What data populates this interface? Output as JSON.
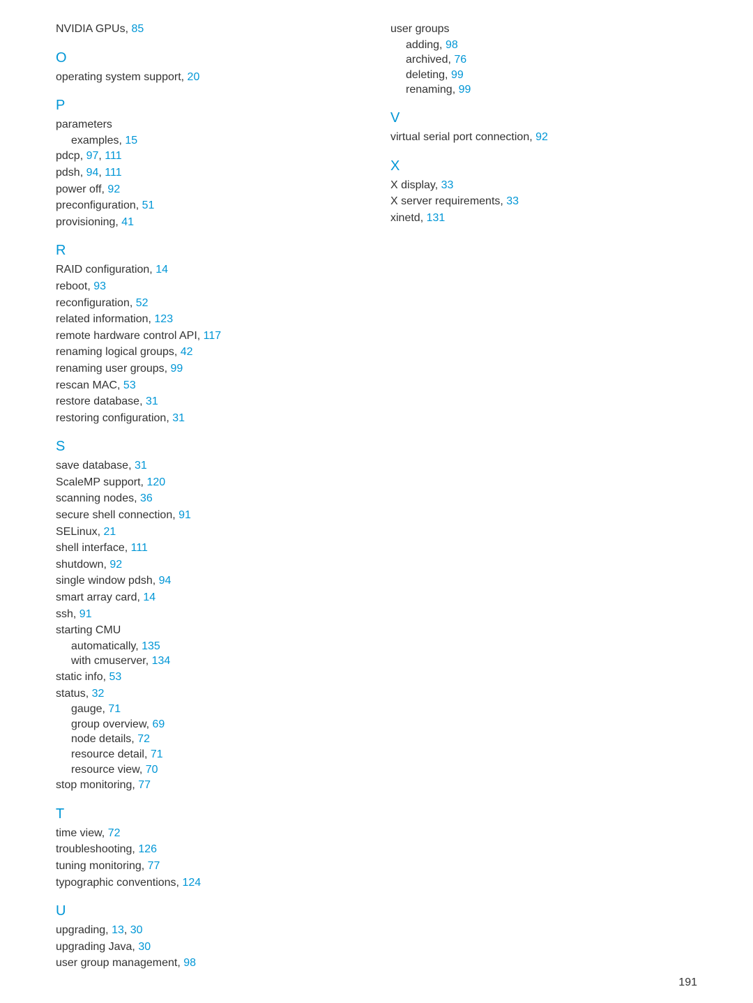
{
  "col1": {
    "prefix": {
      "label": "NVIDIA GPUs, ",
      "pages": "85"
    },
    "sections": [
      {
        "letter": "O",
        "entries": [
          {
            "label": "operating system support, ",
            "pages": "20"
          }
        ]
      },
      {
        "letter": "P",
        "entries": [
          {
            "label": "parameters"
          },
          {
            "label": "examples, ",
            "pages": "15",
            "sub": true
          },
          {
            "label": "pdcp, ",
            "pages": "97, 111"
          },
          {
            "label": "pdsh, ",
            "pages": "94, 111"
          },
          {
            "label": "power off, ",
            "pages": "92"
          },
          {
            "label": "preconfiguration, ",
            "pages": "51"
          },
          {
            "label": "provisioning, ",
            "pages": "41"
          }
        ]
      },
      {
        "letter": "R",
        "entries": [
          {
            "label": "RAID configuration, ",
            "pages": "14"
          },
          {
            "label": "reboot, ",
            "pages": "93"
          },
          {
            "label": "reconfiguration, ",
            "pages": "52"
          },
          {
            "label": "related information, ",
            "pages": "123"
          },
          {
            "label": "remote hardware control API, ",
            "pages": "117"
          },
          {
            "label": "renaming logical groups, ",
            "pages": "42"
          },
          {
            "label": "renaming user groups, ",
            "pages": "99"
          },
          {
            "label": "rescan MAC, ",
            "pages": "53"
          },
          {
            "label": "restore database, ",
            "pages": "31"
          },
          {
            "label": "restoring configuration, ",
            "pages": "31"
          }
        ]
      },
      {
        "letter": "S",
        "entries": [
          {
            "label": "save database, ",
            "pages": "31"
          },
          {
            "label": "ScaleMP support, ",
            "pages": "120"
          },
          {
            "label": "scanning nodes, ",
            "pages": "36"
          },
          {
            "label": "secure shell connection, ",
            "pages": "91"
          },
          {
            "label": "SELinux, ",
            "pages": "21"
          },
          {
            "label": "shell interface, ",
            "pages": "111"
          },
          {
            "label": "shutdown, ",
            "pages": "92"
          },
          {
            "label": "single window pdsh, ",
            "pages": "94"
          },
          {
            "label": "smart array card, ",
            "pages": "14"
          },
          {
            "label": "ssh, ",
            "pages": "91"
          },
          {
            "label": "starting CMU"
          },
          {
            "label": "automatically, ",
            "pages": "135",
            "sub": true
          },
          {
            "label": "with cmuserver, ",
            "pages": "134",
            "sub": true
          },
          {
            "label": "static info, ",
            "pages": "53"
          },
          {
            "label": "status, ",
            "pages": "32"
          },
          {
            "label": "gauge, ",
            "pages": "71",
            "sub": true
          },
          {
            "label": "group overview, ",
            "pages": "69",
            "sub": true
          },
          {
            "label": "node details, ",
            "pages": "72",
            "sub": true
          },
          {
            "label": "resource detail, ",
            "pages": "71",
            "sub": true
          },
          {
            "label": "resource view, ",
            "pages": "70",
            "sub": true
          },
          {
            "label": "stop monitoring, ",
            "pages": "77"
          }
        ]
      },
      {
        "letter": "T",
        "entries": [
          {
            "label": "time view, ",
            "pages": "72"
          },
          {
            "label": "troubleshooting, ",
            "pages": "126"
          },
          {
            "label": "tuning monitoring, ",
            "pages": "77"
          },
          {
            "label": "typographic conventions, ",
            "pages": "124"
          }
        ]
      },
      {
        "letter": "U",
        "entries": [
          {
            "label": "upgrading, ",
            "pages": "13, 30"
          },
          {
            "label": "upgrading Java, ",
            "pages": "30"
          },
          {
            "label": "user group management, ",
            "pages": "98"
          }
        ]
      }
    ]
  },
  "col2": {
    "prefix_entries": [
      {
        "label": "user groups"
      },
      {
        "label": "adding, ",
        "pages": "98",
        "sub": true
      },
      {
        "label": "archived, ",
        "pages": "76",
        "sub": true
      },
      {
        "label": "deleting, ",
        "pages": "99",
        "sub": true
      },
      {
        "label": "renaming, ",
        "pages": "99",
        "sub": true
      }
    ],
    "sections": [
      {
        "letter": "V",
        "entries": [
          {
            "label": "virtual serial port connection, ",
            "pages": "92"
          }
        ]
      },
      {
        "letter": "X",
        "entries": [
          {
            "label": "X display, ",
            "pages": "33"
          },
          {
            "label": "X server requirements, ",
            "pages": "33"
          },
          {
            "label": "xinetd, ",
            "pages": "131"
          }
        ]
      }
    ]
  },
  "page_number": "191"
}
